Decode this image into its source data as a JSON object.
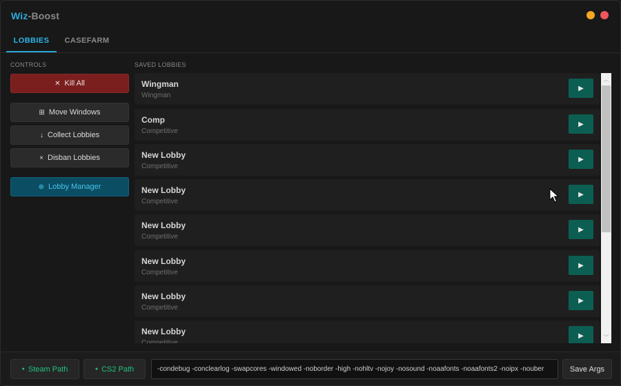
{
  "app": {
    "title_part1": "Wiz",
    "title_part2": "-Boost",
    "colors": {
      "accent": "#2aa8d8",
      "background": "#181818",
      "minimize": "#f5a623",
      "close": "#f0565b"
    }
  },
  "tabs": [
    {
      "label": "LOBBIES",
      "active": true
    },
    {
      "label": "CASEFARM",
      "active": false
    }
  ],
  "controls": {
    "label": "CONTROLS",
    "kill_all": {
      "icon": "close-x-icon",
      "label": "Kill All",
      "color": "#7a1e1e"
    },
    "move_windows": {
      "icon": "grid-icon",
      "label": "Move Windows"
    },
    "collect_lobbies": {
      "icon": "arrow-down-icon",
      "label": "Collect Lobbies"
    },
    "disban_lobbies": {
      "icon": "x-icon",
      "label": "Disban Lobbies"
    },
    "lobby_manager": {
      "icon": "globe-icon",
      "label": "Lobby Manager",
      "color": "#0b4d63"
    }
  },
  "lobbies": {
    "label": "SAVED LOBBIES",
    "items": [
      {
        "name": "Wingman",
        "type": "Wingman"
      },
      {
        "name": "Comp",
        "type": "Competitive"
      },
      {
        "name": "New Lobby",
        "type": "Competitive"
      },
      {
        "name": "New Lobby",
        "type": "Competitive"
      },
      {
        "name": "New Lobby",
        "type": "Competitive"
      },
      {
        "name": "New Lobby",
        "type": "Competitive"
      },
      {
        "name": "New Lobby",
        "type": "Competitive"
      },
      {
        "name": "New Lobby",
        "type": "Competitive"
      }
    ],
    "play_icon": "play-icon",
    "play_color": "#0d5e52"
  },
  "bottom": {
    "steam_path": "Steam Path",
    "cs2_path": "CS2 Path",
    "status_color": "#23c27e",
    "args_value": "-condebug -conclearlog -swapcores -windowed -noborder -high -nohltv -nojoy -nosound -noaafonts -noaafonts2 -noipx -nouber",
    "save_args": "Save Args"
  }
}
